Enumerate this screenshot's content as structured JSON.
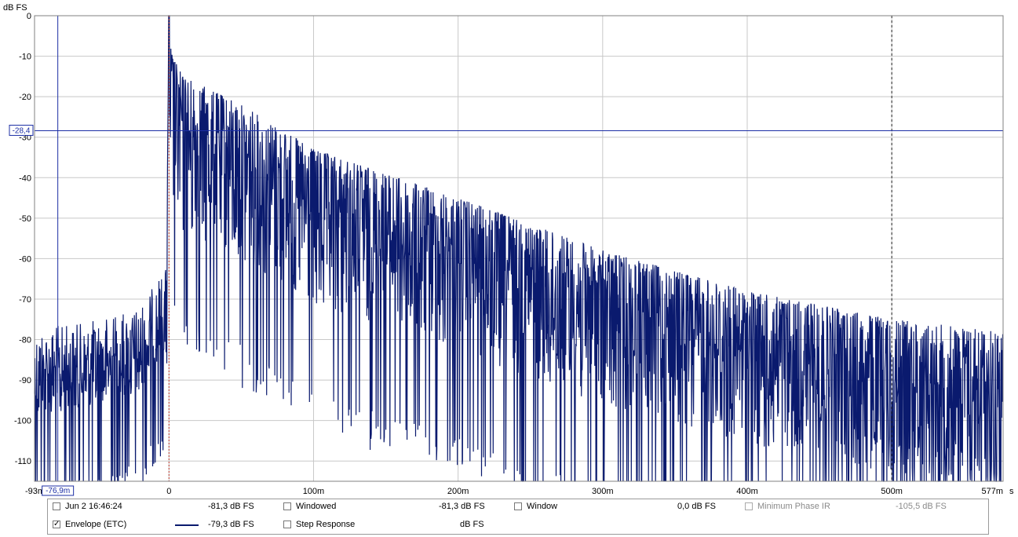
{
  "chart_data": {
    "type": "line",
    "title": "",
    "ylabel": "dB FS",
    "xlabel": "s",
    "xlim": [
      -0.093,
      0.577
    ],
    "ylim": [
      -115,
      0
    ],
    "y_ticks": [
      0,
      -10,
      -20,
      -30,
      -40,
      -50,
      -60,
      -70,
      -80,
      -90,
      -100,
      -110
    ],
    "x_ticks": [
      {
        "value": -0.093,
        "label": "-93m"
      },
      {
        "value": 0,
        "label": "0"
      },
      {
        "value": 0.1,
        "label": "100m"
      },
      {
        "value": 0.2,
        "label": "200m"
      },
      {
        "value": 0.3,
        "label": "300m"
      },
      {
        "value": 0.4,
        "label": "400m"
      },
      {
        "value": 0.5,
        "label": "500m"
      },
      {
        "value": 0.577,
        "label": "577m"
      }
    ],
    "x_unit": "s",
    "grid": true,
    "series": [
      {
        "name": "Envelope (ETC)",
        "color": "#0a1a6e",
        "envelope_peaks": [
          {
            "x": -0.093,
            "y": -77
          },
          {
            "x": -0.06,
            "y": -76
          },
          {
            "x": -0.02,
            "y": -72
          },
          {
            "x": -0.002,
            "y": -62
          },
          {
            "x": 0,
            "y": 0
          },
          {
            "x": 0.01,
            "y": -15
          },
          {
            "x": 0.05,
            "y": -22
          },
          {
            "x": 0.1,
            "y": -33
          },
          {
            "x": 0.2,
            "y": -45
          },
          {
            "x": 0.3,
            "y": -58
          },
          {
            "x": 0.4,
            "y": -68
          },
          {
            "x": 0.5,
            "y": -75
          },
          {
            "x": 0.577,
            "y": -78
          }
        ]
      }
    ],
    "markers": {
      "cursor_x": -0.0769,
      "cursor_x_label": "-76,9m",
      "cursor_y": -28.4,
      "cursor_y_label": "-28,4",
      "peak_x": 0,
      "window_end_x": 0.5
    },
    "colors": {
      "trace": "#0a1a6e",
      "cursor": "#1c2fa5",
      "grid": "#c8c8c8",
      "peak_marker": "#c0392b"
    }
  },
  "legend": {
    "row1": [
      {
        "label": "Jun 2 16:46:24",
        "value": "-81,3 dB FS",
        "checked": false,
        "dim": false
      },
      {
        "label": "Windowed",
        "value": "-81,3 dB FS",
        "checked": false,
        "dim": false
      },
      {
        "label": "Window",
        "value": "0,0 dB FS",
        "checked": false,
        "dim": false
      },
      {
        "label": "Minimum Phase IR",
        "value": "-105,5 dB FS",
        "checked": false,
        "dim": true
      }
    ],
    "row2": [
      {
        "label": "Envelope (ETC)",
        "value": "-79,3 dB FS",
        "checked": true,
        "dim": false
      },
      {
        "label": "Step Response",
        "value": "dB FS",
        "checked": false,
        "dim": false
      }
    ]
  }
}
